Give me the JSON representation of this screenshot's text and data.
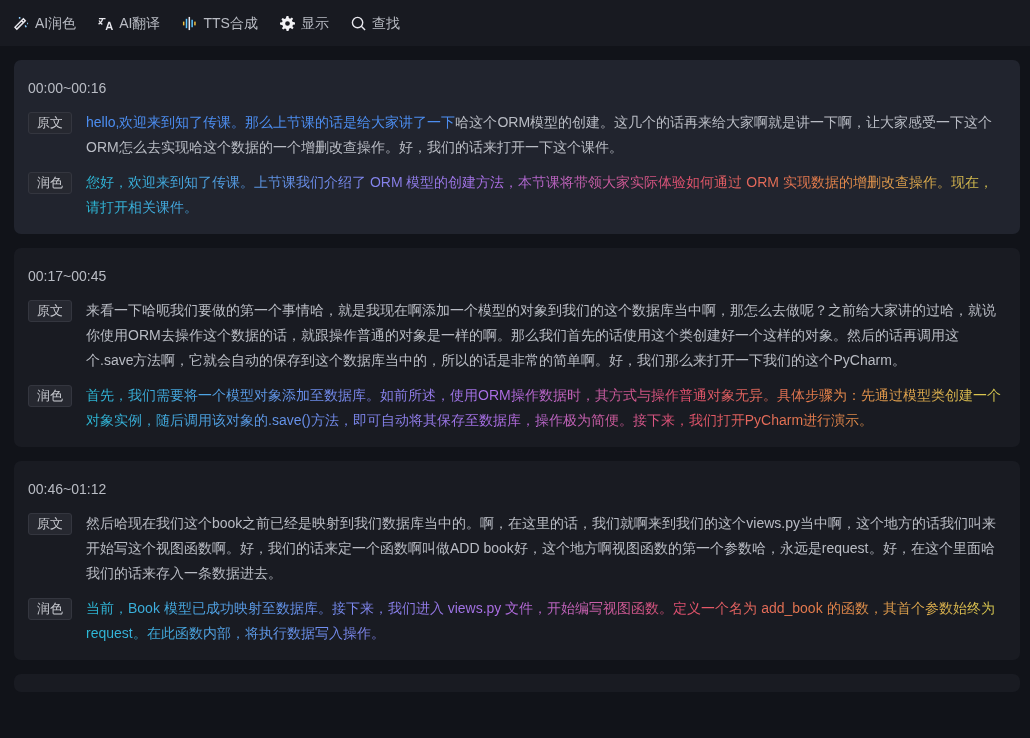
{
  "toolbar": [
    {
      "kind": "polish",
      "label": "AI润色"
    },
    {
      "kind": "translate",
      "label": "AI翻译"
    },
    {
      "kind": "tts",
      "label": "TTS合成"
    },
    {
      "kind": "display",
      "label": "显示"
    },
    {
      "kind": "search",
      "label": "查找"
    }
  ],
  "segments": [
    {
      "selected": true,
      "time": "00:00~00:16",
      "original_label": "原文",
      "original": [
        {
          "text": "hello,欢迎来到知了传课。那么上节课的话是给大家讲了一下",
          "highlighted": true
        },
        {
          "text": "哈这个ORM模型的创建。这几个的话再来给大家啊就是讲一下啊，让大家感受一下这个ORM怎么去实现哈这个数据的一个增删改查操作。好，我们的话来打开一下这个课件。",
          "highlighted": false
        }
      ],
      "polished_label": "润色",
      "polished": "您好，欢迎来到知了传课。上节课我们介绍了 ORM 模型的创建方法，本节课将带领大家实际体验如何通过 ORM 实现数据的增删改查操作。现在，请打开相关课件。"
    },
    {
      "selected": false,
      "time": "00:17~00:45",
      "original_label": "原文",
      "original": [
        {
          "text": "来看一下哈呃我们要做的第一个事情哈，就是我现在啊添加一个模型的对象到我们的这个数据库当中啊，那怎么去做呢？之前给大家讲的过哈，就说你使用ORM去操作这个数据的话，就跟操作普通的对象是一样的啊。那么我们首先的话使用这个类创建好一个这样的对象。然后的话再调用这个.save方法啊，它就会自动的保存到这个数据库当中的，所以的话是非常的简单啊。好，我们那么来打开一下我们的这个PyCharm。",
          "highlighted": false
        }
      ],
      "polished_label": "润色",
      "polished": "首先，我们需要将一个模型对象添加至数据库。如前所述，使用ORM操作数据时，其方式与操作普通对象无异。具体步骤为：先通过模型类创建一个对象实例，随后调用该对象的.save()方法，即可自动将其保存至数据库，操作极为简便。接下来，我们打开PyCharm进行演示。"
    },
    {
      "selected": false,
      "time": "00:46~01:12",
      "original_label": "原文",
      "original": [
        {
          "text": "然后哈现在我们这个book之前已经是映射到我们数据库当中的。啊，在这里的话，我们就啊来到我们的这个views.py当中啊，这个地方的话我们叫来开始写这个视图函数啊。好，我们的话来定一个函数啊叫做ADD book好，这个地方啊视图函数的第一个参数哈，永远是request。好，在这个里面哈我们的话来存入一条数据进去。",
          "highlighted": false
        }
      ],
      "polished_label": "润色",
      "polished": "当前，Book 模型已成功映射至数据库。接下来，我们进入 views.py 文件，开始编写视图函数。定义一个名为 add_book 的函数，其首个参数始终为request。在此函数内部，将执行数据写入操作。"
    },
    {
      "selected": false
    }
  ]
}
